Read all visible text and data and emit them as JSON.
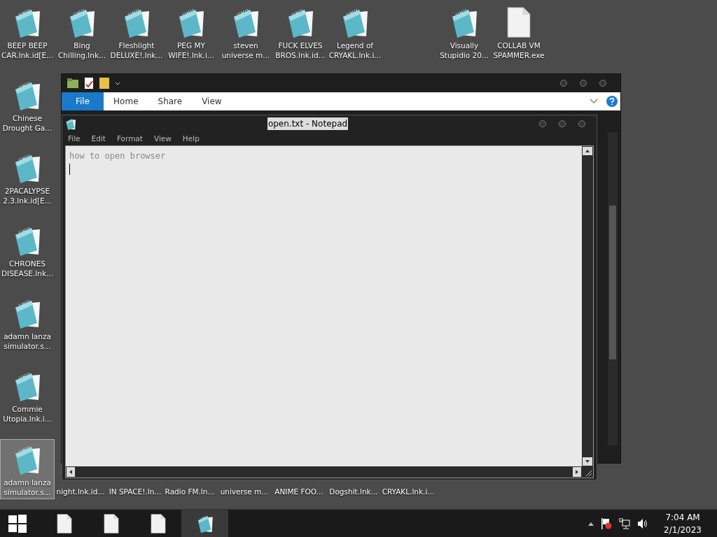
{
  "desktop_icons": [
    {
      "kind": "notepad",
      "lines": [
        "BEEP BEEP",
        "CAR.lnk.id[E..."
      ],
      "selected": false
    },
    {
      "kind": "notepad",
      "lines": [
        "Bing",
        "Chilling.lnk..."
      ],
      "selected": false
    },
    {
      "kind": "notepad",
      "lines": [
        "Fleshlight",
        "DELUXE!.lnk..."
      ],
      "selected": false
    },
    {
      "kind": "notepad",
      "lines": [
        "PEG MY",
        "WIFE!.lnk.i..."
      ],
      "selected": false
    },
    {
      "kind": "notepad",
      "lines": [
        "steven",
        "universe m..."
      ],
      "selected": false
    },
    {
      "kind": "notepad",
      "lines": [
        "FUCK ELVES",
        "BROS.lnk.id..."
      ],
      "selected": false
    },
    {
      "kind": "notepad",
      "lines": [
        "Legend of",
        "CRYAKL.lnk.i..."
      ],
      "selected": false
    },
    {
      "kind": "notepad",
      "lines": [
        "Visually",
        "Stupidio 20..."
      ],
      "selected": false
    },
    {
      "kind": "file",
      "lines": [
        "COLLAB VM",
        "SPAMMER.exe"
      ],
      "selected": false
    },
    {
      "kind": "notepad",
      "lines": [
        "Chinese",
        "Drought Ga..."
      ],
      "selected": false
    },
    {
      "kind": "notepad",
      "lines": [
        "2PACALYPSE",
        "2.3.lnk.id[E..."
      ],
      "selected": false
    },
    {
      "kind": "notepad",
      "lines": [
        "CHRONES",
        "DISEASE.lnk..."
      ],
      "selected": false
    },
    {
      "kind": "notepad",
      "lines": [
        "adamn lanza",
        "simulator.s..."
      ],
      "selected": false
    },
    {
      "kind": "notepad",
      "lines": [
        "Commie",
        "Utopia.lnk.i..."
      ],
      "selected": false
    },
    {
      "kind": "notepad",
      "lines": [
        "adamn lanza",
        "simulator.s..."
      ],
      "selected": true
    }
  ],
  "hidden_icon_labels": [
    "night.lnk.id...",
    "IN SPACE!.ln...",
    "Radio FM.ln...",
    "universe m...",
    "ANIME FOO...",
    "Dogshit.lnk...",
    "CRYAKL.lnk.i..."
  ],
  "explorer": {
    "tabs": [
      {
        "label": "File",
        "selected": true
      },
      {
        "label": "Home",
        "selected": false
      },
      {
        "label": "Share",
        "selected": false
      },
      {
        "label": "View",
        "selected": false
      }
    ]
  },
  "notepad": {
    "title": "open.txt - Notepad",
    "menu": [
      "File",
      "Edit",
      "Format",
      "View",
      "Help"
    ],
    "text": "how to open browser"
  },
  "taskbar": {
    "items": [
      {
        "kind": "file",
        "active": false
      },
      {
        "kind": "file",
        "active": false
      },
      {
        "kind": "file",
        "active": false
      },
      {
        "kind": "notepad",
        "active": true
      }
    ],
    "time": "7:04 AM",
    "date": "2/1/2023"
  }
}
